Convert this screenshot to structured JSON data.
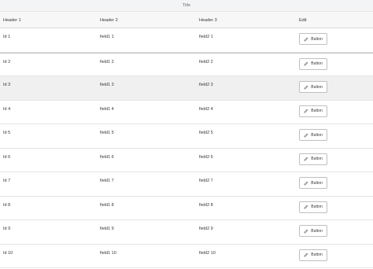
{
  "table": {
    "title": "Title",
    "headers": [
      "Header 1",
      "Header 2",
      "Header 3",
      "Edit"
    ],
    "rows": [
      {
        "id": "Id 1",
        "f1": "field1 1",
        "f2": "field2 1",
        "button": "Button"
      },
      {
        "id": "Id 2",
        "f1": "field1 2",
        "f2": "field2 2",
        "button": "Button"
      },
      {
        "id": "Id 3",
        "f1": "field1 3",
        "f2": "field2 3",
        "button": "Button"
      },
      {
        "id": "Id 4",
        "f1": "field1 4",
        "f2": "field2 4",
        "button": "Button"
      },
      {
        "id": "Id 5",
        "f1": "field1 5",
        "f2": "field2 5",
        "button": "Button"
      },
      {
        "id": "Id 6",
        "f1": "field1 6",
        "f2": "field2 6",
        "button": "Button"
      },
      {
        "id": "Id 7",
        "f1": "field1 7",
        "f2": "field2 7",
        "button": "Button"
      },
      {
        "id": "Id 8",
        "f1": "field1 8",
        "f2": "field2 8",
        "button": "Button"
      },
      {
        "id": "Id 9",
        "f1": "field1 9",
        "f2": "field2 9",
        "button": "Button"
      },
      {
        "id": "Id 10",
        "f1": "field1 10",
        "f2": "field2 10",
        "button": "Button"
      }
    ],
    "button_icon": "edit-pencil-icon"
  }
}
